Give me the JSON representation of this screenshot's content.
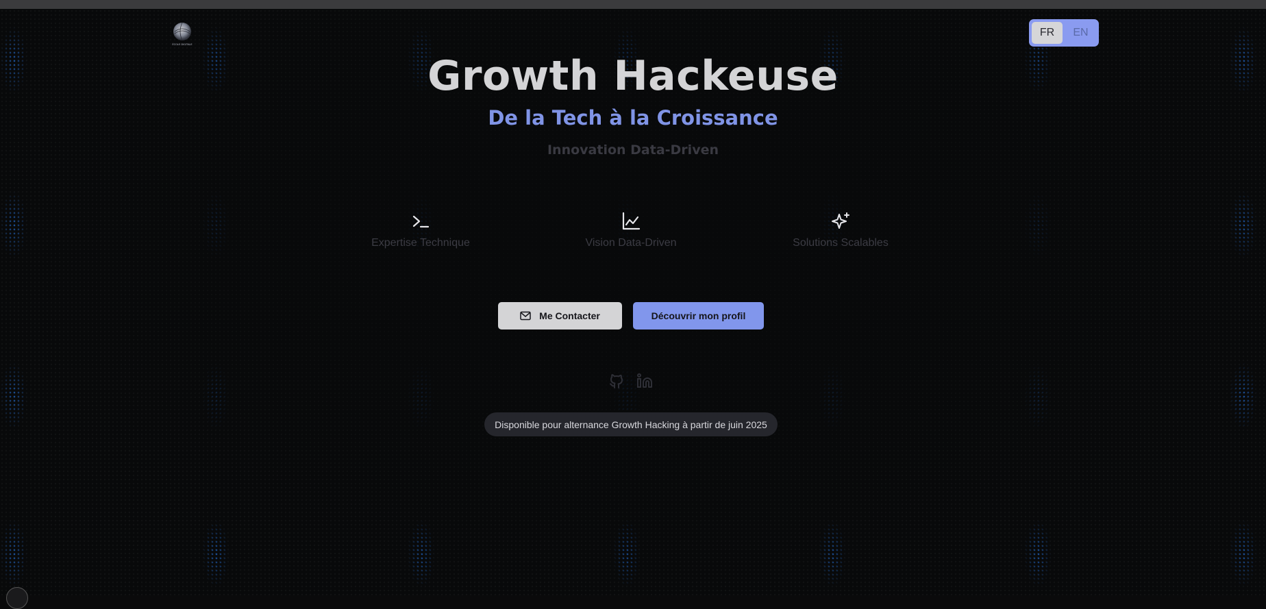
{
  "header": {
    "logo_icon": "globe-logo-icon",
    "logo_caption": "ÉCOLE DIGITALE",
    "languages": [
      {
        "code": "FR",
        "active": true
      },
      {
        "code": "EN",
        "active": false
      }
    ]
  },
  "hero": {
    "title": "Growth Hackeuse",
    "subtitle": "De la Tech à la Croissance",
    "tagline": "Innovation Data-Driven"
  },
  "features": [
    {
      "icon": "terminal-icon",
      "label": "Expertise Technique"
    },
    {
      "icon": "line-chart-icon",
      "label": "Vision Data-Driven"
    },
    {
      "icon": "sparkles-icon",
      "label": "Solutions Scalables"
    }
  ],
  "actions": {
    "contact_label": "Me Contacter",
    "contact_icon": "mail-icon",
    "profile_label": "Découvrir mon profil"
  },
  "social": [
    {
      "icon": "github-icon"
    },
    {
      "icon": "linkedin-icon"
    }
  ],
  "availability": "Disponible pour alternance Growth Hacking à partir de juin 2025",
  "colors": {
    "accent": "#8196ec",
    "background": "#08090a",
    "glow": "#2882ff",
    "title": "#d4d4d6"
  }
}
